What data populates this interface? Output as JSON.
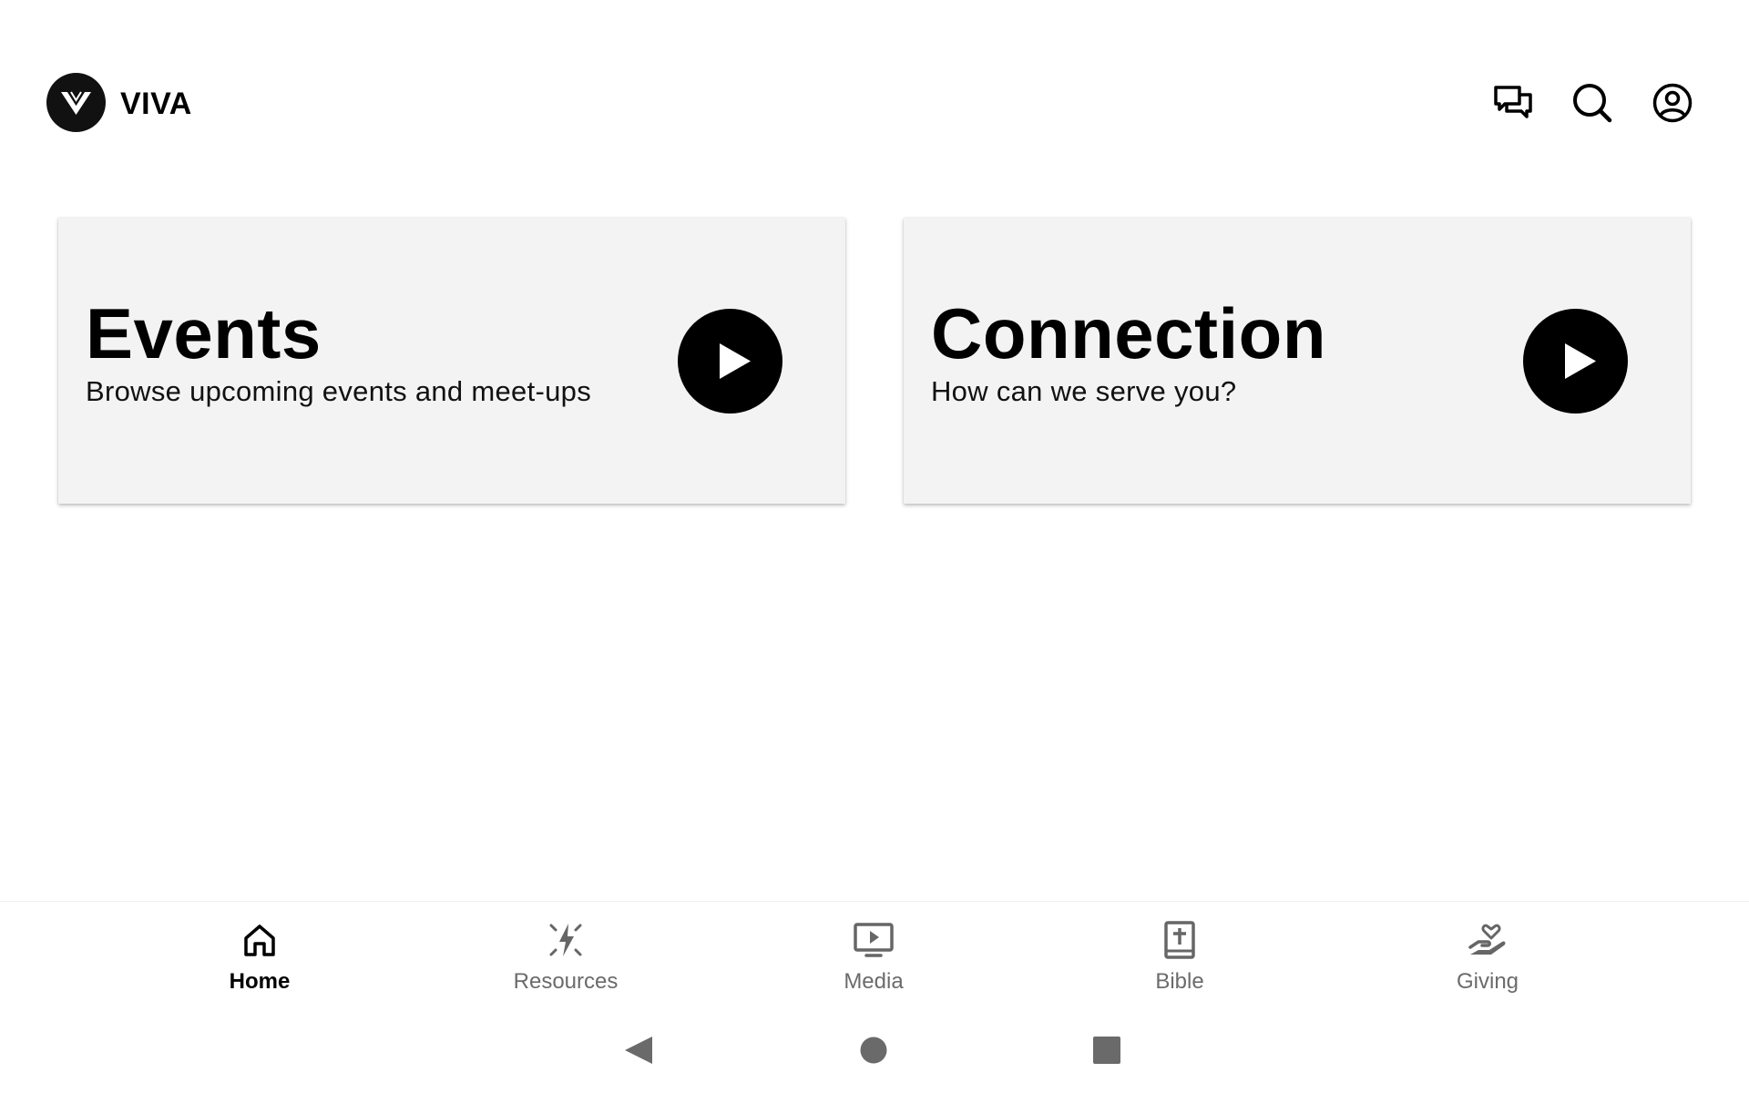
{
  "app": {
    "title": "VIVA",
    "logo_icon": "viva-v-logo-icon"
  },
  "header": {
    "actions": [
      {
        "name": "chat",
        "icon": "chat-bubbles-icon"
      },
      {
        "name": "search",
        "icon": "search-icon"
      },
      {
        "name": "account",
        "icon": "account-circle-icon"
      }
    ]
  },
  "cards": {
    "events": {
      "title": "Events",
      "subtitle": "Browse upcoming events and meet-ups",
      "button_icon": "play-icon"
    },
    "connection": {
      "title": "Connection",
      "subtitle": "How can we serve you?",
      "button_icon": "play-icon"
    }
  },
  "bottom_nav": {
    "active": "Home",
    "items": [
      {
        "label": "Home",
        "icon": "home-icon"
      },
      {
        "label": "Resources",
        "icon": "sparkle-bolt-icon"
      },
      {
        "label": "Media",
        "icon": "tv-play-icon"
      },
      {
        "label": "Bible",
        "icon": "bible-cross-icon"
      },
      {
        "label": "Giving",
        "icon": "hand-heart-icon"
      }
    ]
  },
  "system_nav": {
    "buttons": [
      "back-triangle-icon",
      "home-circle-icon",
      "recents-square-icon"
    ]
  },
  "colors": {
    "background": "#ffffff",
    "card": "#f3f3f3",
    "accent": "#000000",
    "inactive": "#6b6b6b",
    "system_nav": "#6a6a6a"
  }
}
